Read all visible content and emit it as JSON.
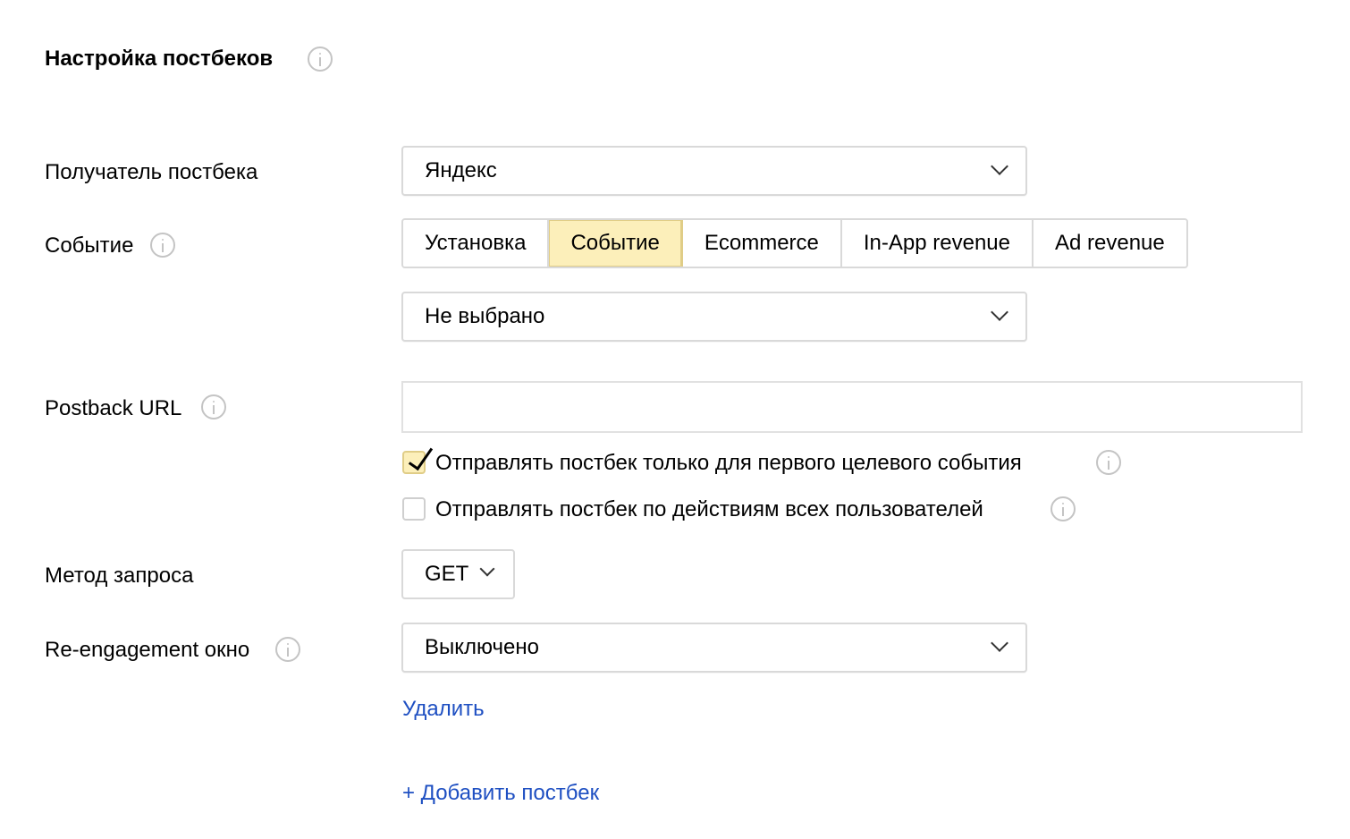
{
  "header": {
    "title": "Настройка постбеков"
  },
  "recipient": {
    "label": "Получатель постбека",
    "value": "Яндекс"
  },
  "event": {
    "label": "Событие",
    "tabs": [
      {
        "label": "Установка",
        "active": false
      },
      {
        "label": "Событие",
        "active": true
      },
      {
        "label": "Ecommerce",
        "active": false
      },
      {
        "label": "In-App revenue",
        "active": false
      },
      {
        "label": "Ad revenue",
        "active": false
      }
    ],
    "select_value": "Не выбрано"
  },
  "postback_url": {
    "label": "Postback URL",
    "value": ""
  },
  "options": {
    "first_event_only": {
      "label": "Отправлять постбек только для первого целевого события",
      "checked": true
    },
    "all_users": {
      "label": "Отправлять постбек по действиям всех пользователей",
      "checked": false
    }
  },
  "method": {
    "label": "Метод запроса",
    "value": "GET"
  },
  "reengagement": {
    "label": "Re-engagement окно",
    "value": "Выключено"
  },
  "actions": {
    "delete_label": "Удалить",
    "add_label": "+ Добавить постбек"
  },
  "colors": {
    "accent_yellow": "#fcefba",
    "link_blue": "#1e4fc2",
    "border_gray": "#d9d9d9",
    "icon_gray": "#c4c4c4"
  }
}
